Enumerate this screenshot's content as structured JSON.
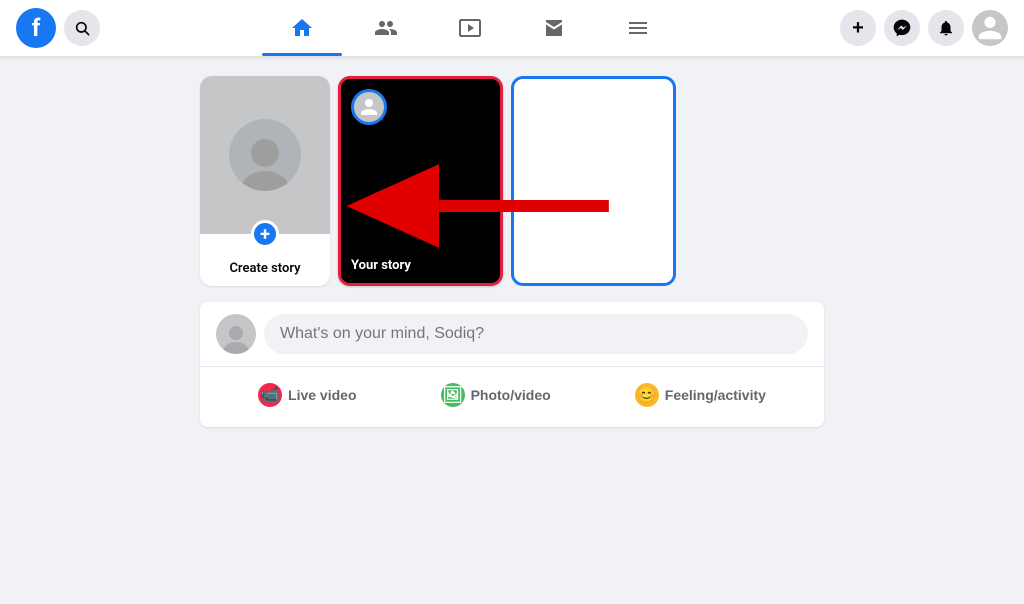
{
  "navbar": {
    "logo_letter": "f",
    "search_tooltip": "Search",
    "nav_items": [
      {
        "id": "home",
        "label": "Home",
        "active": true
      },
      {
        "id": "friends",
        "label": "Friends",
        "active": false
      },
      {
        "id": "watch",
        "label": "Watch",
        "active": false
      },
      {
        "id": "marketplace",
        "label": "Marketplace",
        "active": false
      },
      {
        "id": "menu",
        "label": "Menu",
        "active": false
      }
    ],
    "create_label": "+",
    "messenger_label": "Messenger",
    "notifications_label": "Notifications",
    "account_label": "Account"
  },
  "stories": {
    "create_story_label": "Create story",
    "your_story_label": "Your story"
  },
  "post_box": {
    "placeholder": "What's on your mind, Sodiq?",
    "actions": [
      {
        "id": "live",
        "label": "Live video",
        "icon": "🎥"
      },
      {
        "id": "photo",
        "label": "Photo/video",
        "icon": "🖼"
      },
      {
        "id": "feeling",
        "label": "Feeling/activity",
        "icon": "😊"
      }
    ]
  }
}
